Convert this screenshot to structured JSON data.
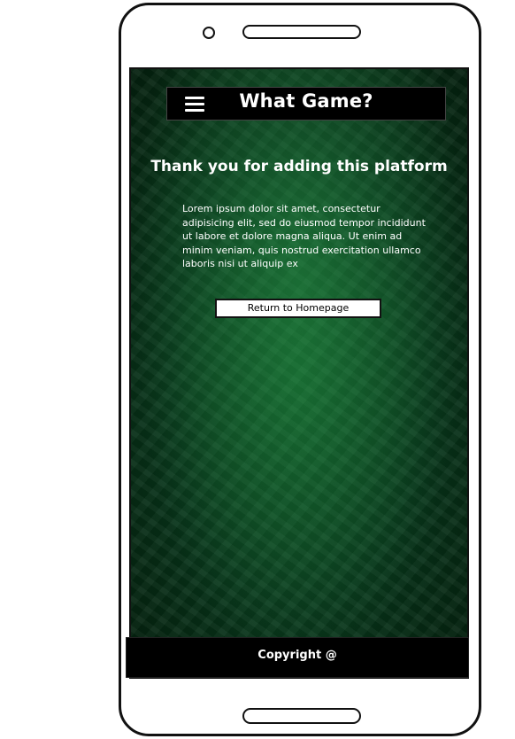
{
  "header": {
    "title": "What Game?",
    "menu_icon": "hamburger-menu-icon"
  },
  "main": {
    "heading": "Thank you for adding this platform",
    "body": "Lorem ipsum dolor sit amet, consectetur adipisicing elit, sed do eiusmod tempor incididunt ut labore et dolore magna aliqua. Ut enim ad minim veniam, quis nostrud exercitation ullamco laboris nisi ut aliquip ex",
    "return_button": "Return to Homepage"
  },
  "footer": {
    "copyright": "Copyright @"
  },
  "colors": {
    "screen_background": "#0b4a20",
    "bar_background": "#000000",
    "text": "#ffffff"
  }
}
